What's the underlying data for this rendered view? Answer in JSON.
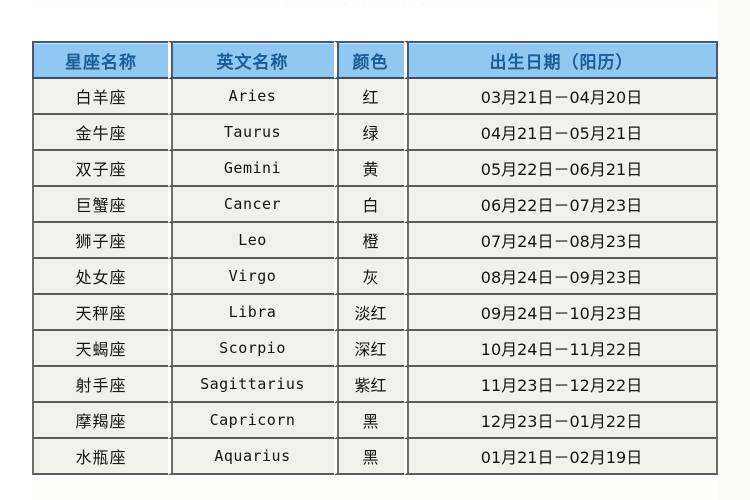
{
  "page": {
    "top_remnant_text": "· · · · ·   · ·   · · · ·"
  },
  "table": {
    "headers": {
      "name": "星座名称",
      "english": "英文名称",
      "color": "颜色",
      "birth_date": "出生日期（阳历）"
    },
    "rows": [
      {
        "name": "白羊座",
        "english": "Aries",
        "color": "红",
        "birth_date": "03月21日－04月20日"
      },
      {
        "name": "金牛座",
        "english": "Taurus",
        "color": "绿",
        "birth_date": "04月21日－05月21日"
      },
      {
        "name": "双子座",
        "english": "Gemini",
        "color": "黄",
        "birth_date": "05月22日－06月21日"
      },
      {
        "name": "巨蟹座",
        "english": "Cancer",
        "color": "白",
        "birth_date": "06月22日－07月23日"
      },
      {
        "name": "狮子座",
        "english": "Leo",
        "color": "橙",
        "birth_date": "07月24日－08月23日"
      },
      {
        "name": "处女座",
        "english": "Virgo",
        "color": "灰",
        "birth_date": "08月24日－09月23日"
      },
      {
        "name": "天秤座",
        "english": "Libra",
        "color": "淡红",
        "birth_date": "09月24日－10月23日"
      },
      {
        "name": "天蝎座",
        "english": "Scorpio",
        "color": "深红",
        "birth_date": "10月24日－11月22日"
      },
      {
        "name": "射手座",
        "english": "Sagittarius",
        "color": "紫红",
        "birth_date": "11月23日－12月22日"
      },
      {
        "name": "摩羯座",
        "english": "Capricorn",
        "color": "黑",
        "birth_date": "12月23日－01月22日"
      },
      {
        "name": "水瓶座",
        "english": "Aquarius",
        "color": "黑",
        "birth_date": "01月21日－02月19日"
      }
    ]
  },
  "colors": {
    "header_background": "#8fc9f2",
    "header_text": "#1d5d93",
    "cell_background": "#f1f1ec",
    "cell_text": "#15150f",
    "border": "#5c5c55",
    "page_background": "#ffffff"
  }
}
